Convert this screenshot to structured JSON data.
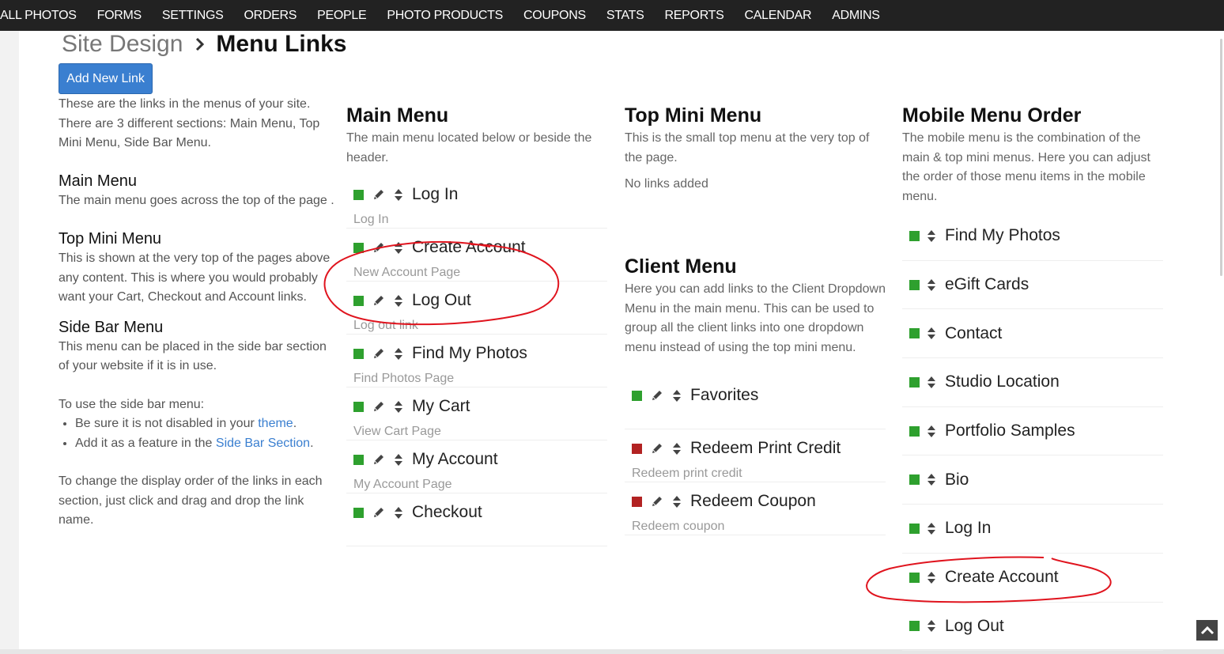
{
  "nav": {
    "items": [
      "ALL PHOTOS",
      "FORMS",
      "SETTINGS",
      "ORDERS",
      "PEOPLE",
      "PHOTO PRODUCTS",
      "COUPONS",
      "STATS",
      "REPORTS",
      "CALENDAR",
      "ADMINS"
    ]
  },
  "breadcrumb": {
    "parent": "Site Design",
    "current": "Menu Links"
  },
  "add_button_label": "Add New Link",
  "help": {
    "intro": "These are the links in the menus of your site. There are 3 different sections: Main Menu, Top Mini Menu, Side Bar Menu.",
    "main_menu_title": "Main Menu",
    "main_menu_text": "The main menu goes across the top of the page .",
    "top_mini_title": "Top Mini Menu",
    "top_mini_text": "This is shown at the very top of the pages above any content. This is where you would probably want your Cart, Checkout and Account links.",
    "side_bar_title": "Side Bar Menu",
    "side_bar_text": "This menu can be placed in the side bar section of your website if it is in use.",
    "side_bar_use": "To use the side bar menu:",
    "bullet1_text": "Be sure it is not disabled in your ",
    "bullet1_link": "theme",
    "bullet1_end": ".",
    "bullet2_text": "Add it as a feature in the ",
    "bullet2_link": "Side Bar Section",
    "bullet2_end": ".",
    "order_text": "To change the display order of the links in each section, just click and drag and drop the link name."
  },
  "main_menu": {
    "title": "Main Menu",
    "description": "The main menu located below or beside the header.",
    "items": [
      {
        "title": "Log In",
        "subtitle": "Log In",
        "status": "active"
      },
      {
        "title": "Create Account",
        "subtitle": "New Account Page",
        "status": "active"
      },
      {
        "title": "Log Out",
        "subtitle": "Log out link",
        "status": "active"
      },
      {
        "title": "Find My Photos",
        "subtitle": "Find Photos Page",
        "status": "active"
      },
      {
        "title": "My Cart",
        "subtitle": "View Cart Page",
        "status": "active"
      },
      {
        "title": "My Account",
        "subtitle": "My Account Page",
        "status": "active"
      },
      {
        "title": "Checkout",
        "subtitle": "",
        "status": "active"
      }
    ]
  },
  "top_mini_menu": {
    "title": "Top Mini Menu",
    "description": "This is the small top menu at the very top of the page.",
    "empty_text": "No links added"
  },
  "client_menu": {
    "title": "Client Menu",
    "description": "Here you can add links to the Client Dropdown Menu in the main menu. This can be used to group all the client links into one dropdown menu instead of using the top mini menu.",
    "items": [
      {
        "title": "Favorites",
        "subtitle": "",
        "status": "active"
      },
      {
        "title": "Redeem Print Credit",
        "subtitle": "Redeem print credit",
        "status": "disabled"
      },
      {
        "title": "Redeem Coupon",
        "subtitle": "Redeem coupon",
        "status": "disabled"
      }
    ]
  },
  "mobile_menu": {
    "title": "Mobile Menu Order",
    "description": "The mobile menu is the combination of the main & top mini menus. Here you can adjust the order of those menu items in the mobile menu.",
    "items": [
      "Find My Photos",
      "eGift Cards",
      "Contact",
      "Studio Location",
      "Portfolio Samples",
      "Bio",
      "Log In",
      "Create Account",
      "Log Out"
    ]
  },
  "colors": {
    "active": "#2ea02e",
    "disabled": "#b22222",
    "accent": "#3a7fd0",
    "annotation": "#e0141e"
  },
  "icons": {
    "edit": "pencil-icon",
    "sort": "sort-arrows-icon",
    "scroll_top": "chevron-up-icon",
    "breadcrumb_separator": "chevron-right-icon"
  }
}
